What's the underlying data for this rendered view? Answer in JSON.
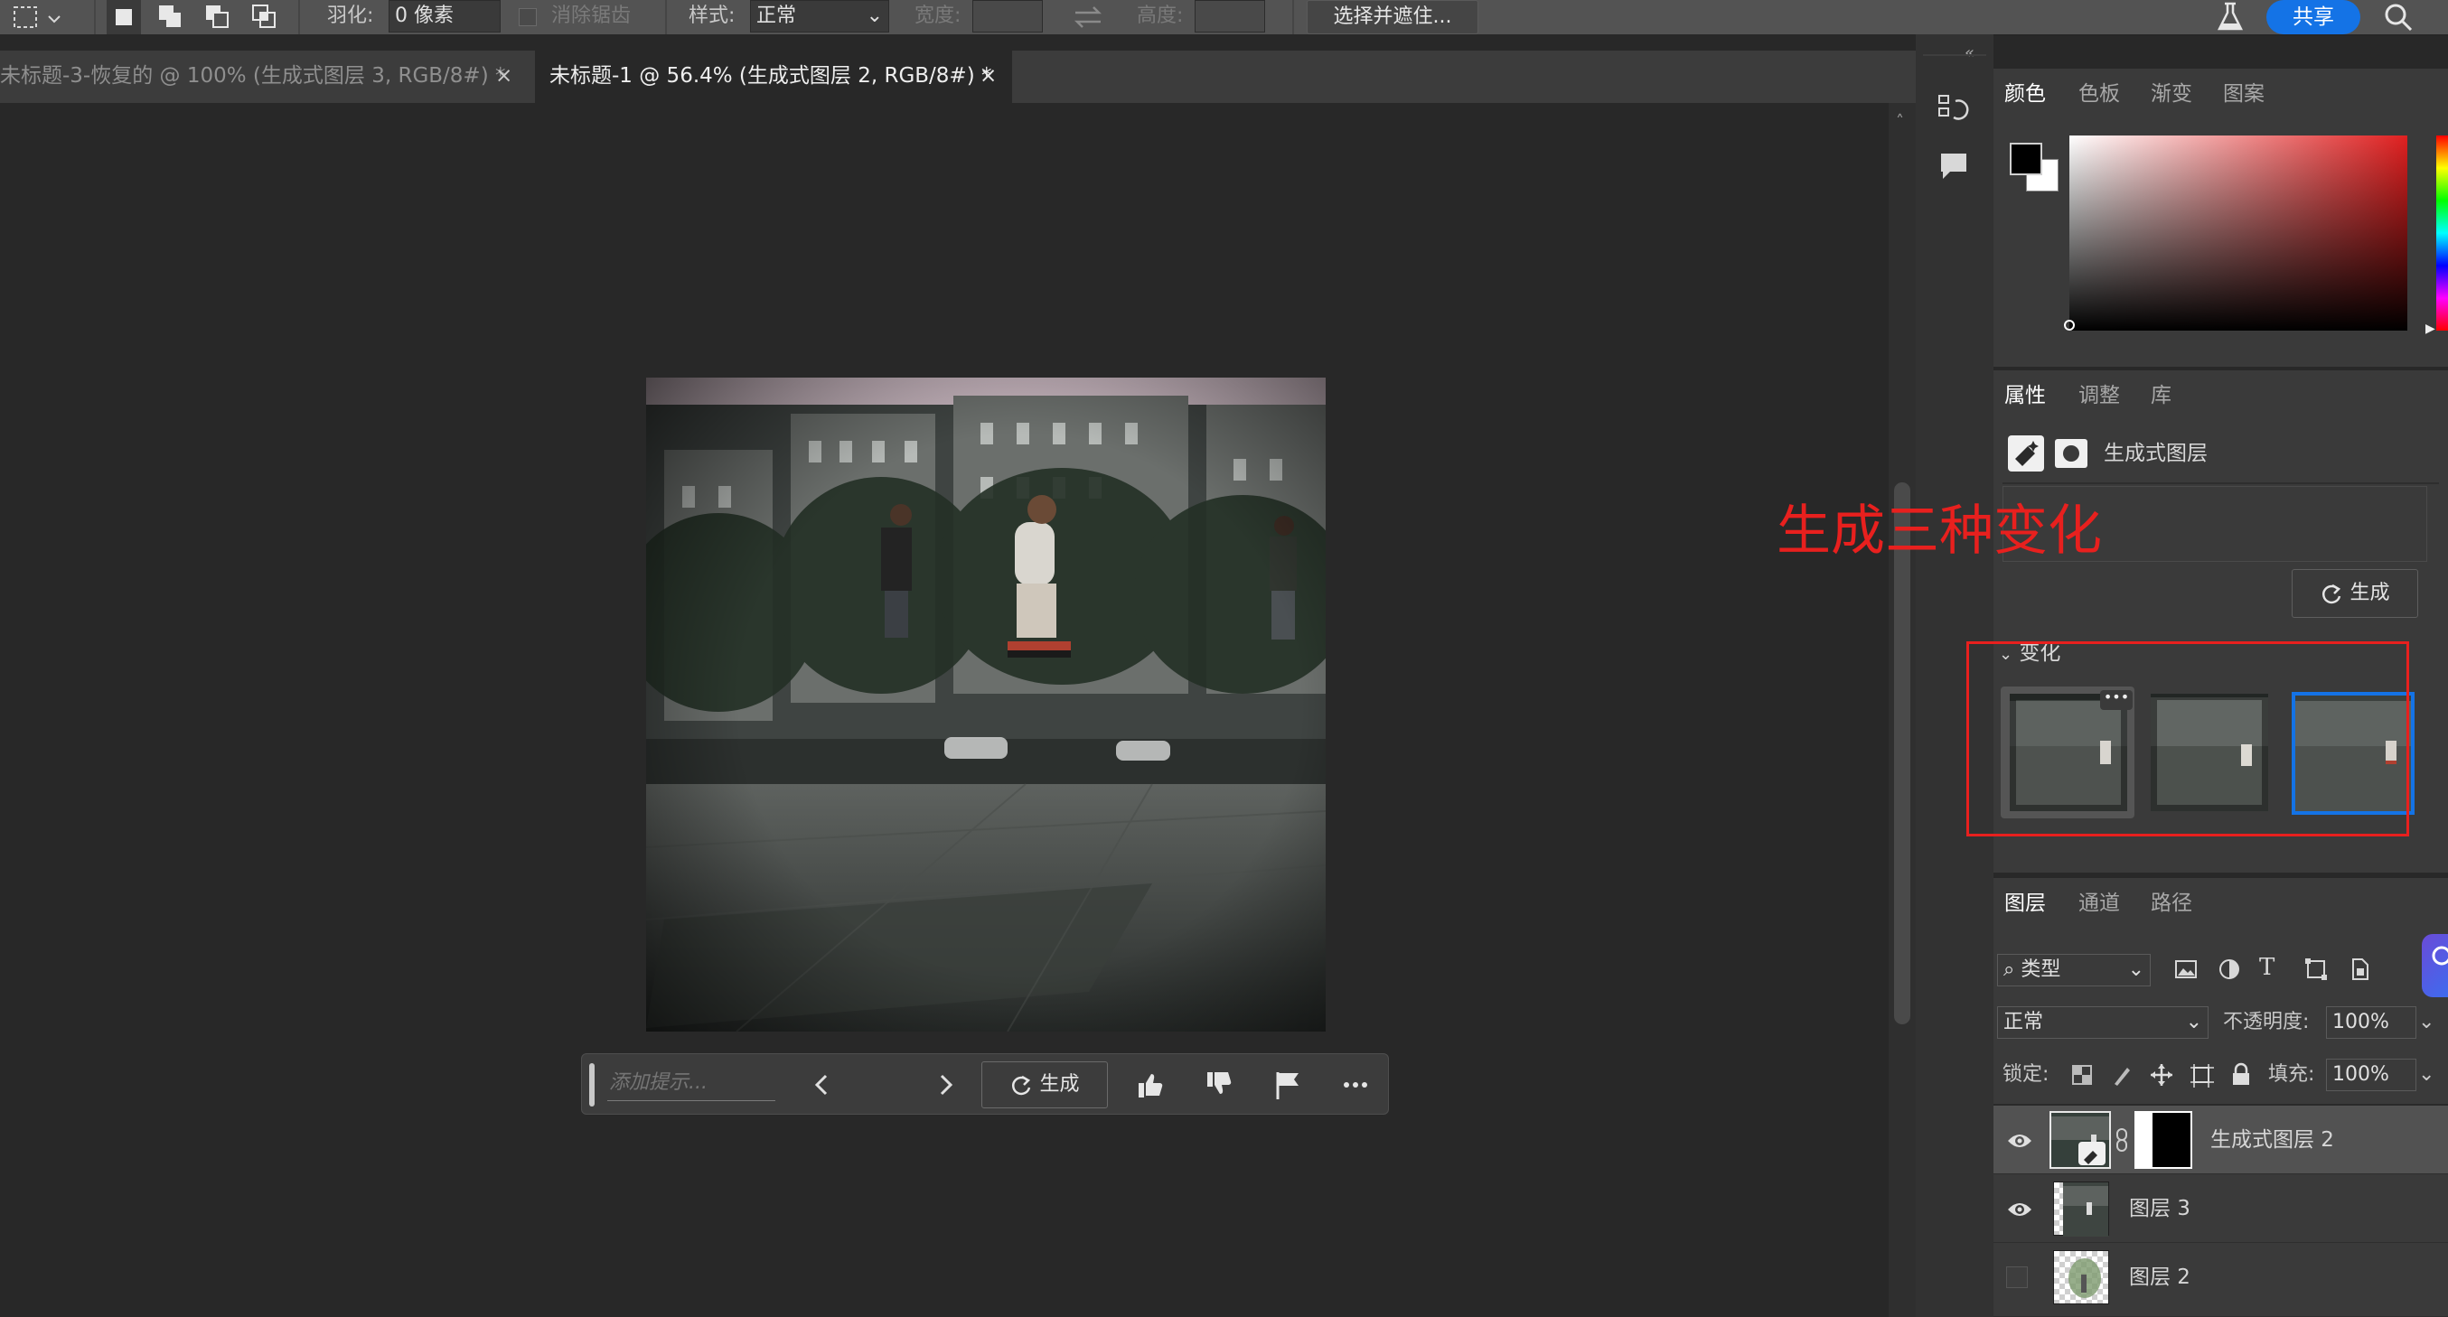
{
  "optionsBar": {
    "feather_label": "羽化:",
    "feather_value": "0 像素",
    "antialias_label": "消除锯齿",
    "style_label": "样式:",
    "style_value": "正常",
    "width_label": "宽度:",
    "height_label": "高度:",
    "select_mask_label": "选择并遮住...",
    "share_label": "共享"
  },
  "tabs": [
    {
      "label": "未标题-3-恢复的 @ 100% (生成式图层 3, RGB/8#) *",
      "active": false
    },
    {
      "label": "未标题-1 @ 56.4% (生成式图层 2, RGB/8#) *",
      "active": true
    }
  ],
  "contextBar": {
    "prompt_placeholder": "添加提示...",
    "generate_label": "生成"
  },
  "colorPanel": {
    "tabs": [
      "颜色",
      "色板",
      "渐变",
      "图案"
    ],
    "foreground": "#000000",
    "background": "#ffffff",
    "hue_color": "#e02020"
  },
  "propertiesPanel": {
    "tabs": [
      "属性",
      "调整",
      "库"
    ],
    "layer_type": "生成式图层",
    "generate_label": "生成",
    "variations_label": "变化"
  },
  "annotation": {
    "text": "生成三种变化",
    "color": "#e8201e"
  },
  "layersPanel": {
    "tabs": [
      "图层",
      "通道",
      "路径"
    ],
    "filter_kind": "类型",
    "blend_mode": "正常",
    "opacity_label": "不透明度:",
    "opacity_value": "100%",
    "lock_label": "锁定:",
    "fill_label": "填充:",
    "fill_value": "100%",
    "layers": [
      {
        "name": "生成式图层 2",
        "visible": true,
        "selected": true
      },
      {
        "name": "图层 3",
        "visible": true,
        "selected": false
      },
      {
        "name": "图层 2",
        "visible": false,
        "selected": false
      }
    ]
  }
}
